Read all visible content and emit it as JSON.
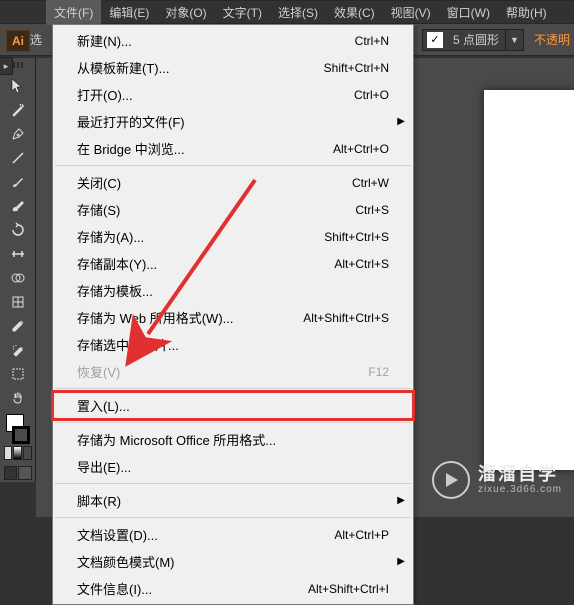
{
  "menubar": {
    "items": [
      "文件(F)",
      "编辑(E)",
      "对象(O)",
      "文字(T)",
      "选择(S)",
      "效果(C)",
      "视图(V)",
      "窗口(W)",
      "帮助(H)"
    ]
  },
  "toolbar": {
    "no_selection": "未选",
    "shape_value": "5 点圆形",
    "opacity_label": "不透明"
  },
  "logo": "Ai",
  "menu": {
    "new": "新建(N)...",
    "new_sc": "Ctrl+N",
    "new_template": "从模板新建(T)...",
    "new_template_sc": "Shift+Ctrl+N",
    "open": "打开(O)...",
    "open_sc": "Ctrl+O",
    "recent": "最近打开的文件(F)",
    "bridge": "在 Bridge 中浏览...",
    "bridge_sc": "Alt+Ctrl+O",
    "close": "关闭(C)",
    "close_sc": "Ctrl+W",
    "save": "存储(S)",
    "save_sc": "Ctrl+S",
    "saveas": "存储为(A)...",
    "saveas_sc": "Shift+Ctrl+S",
    "savecopy": "存储副本(Y)...",
    "savecopy_sc": "Alt+Ctrl+S",
    "savetmpl": "存储为模板...",
    "saveweb": "存储为 Web 所用格式(W)...",
    "saveweb_sc": "Alt+Shift+Ctrl+S",
    "saveslice": "存储选中的切片...",
    "revert": "恢复(V)",
    "revert_sc": "F12",
    "place": "置入(L)...",
    "savems": "存储为 Microsoft Office 所用格式...",
    "export": "导出(E)...",
    "scripts": "脚本(R)",
    "docsetup": "文档设置(D)...",
    "docsetup_sc": "Alt+Ctrl+P",
    "colormode": "文档颜色模式(M)",
    "fileinfo": "文件信息(I)...",
    "fileinfo_sc": "Alt+Shift+Ctrl+I"
  },
  "watermark": {
    "name": "溜溜自学",
    "url": "zixue.3d66.com"
  }
}
